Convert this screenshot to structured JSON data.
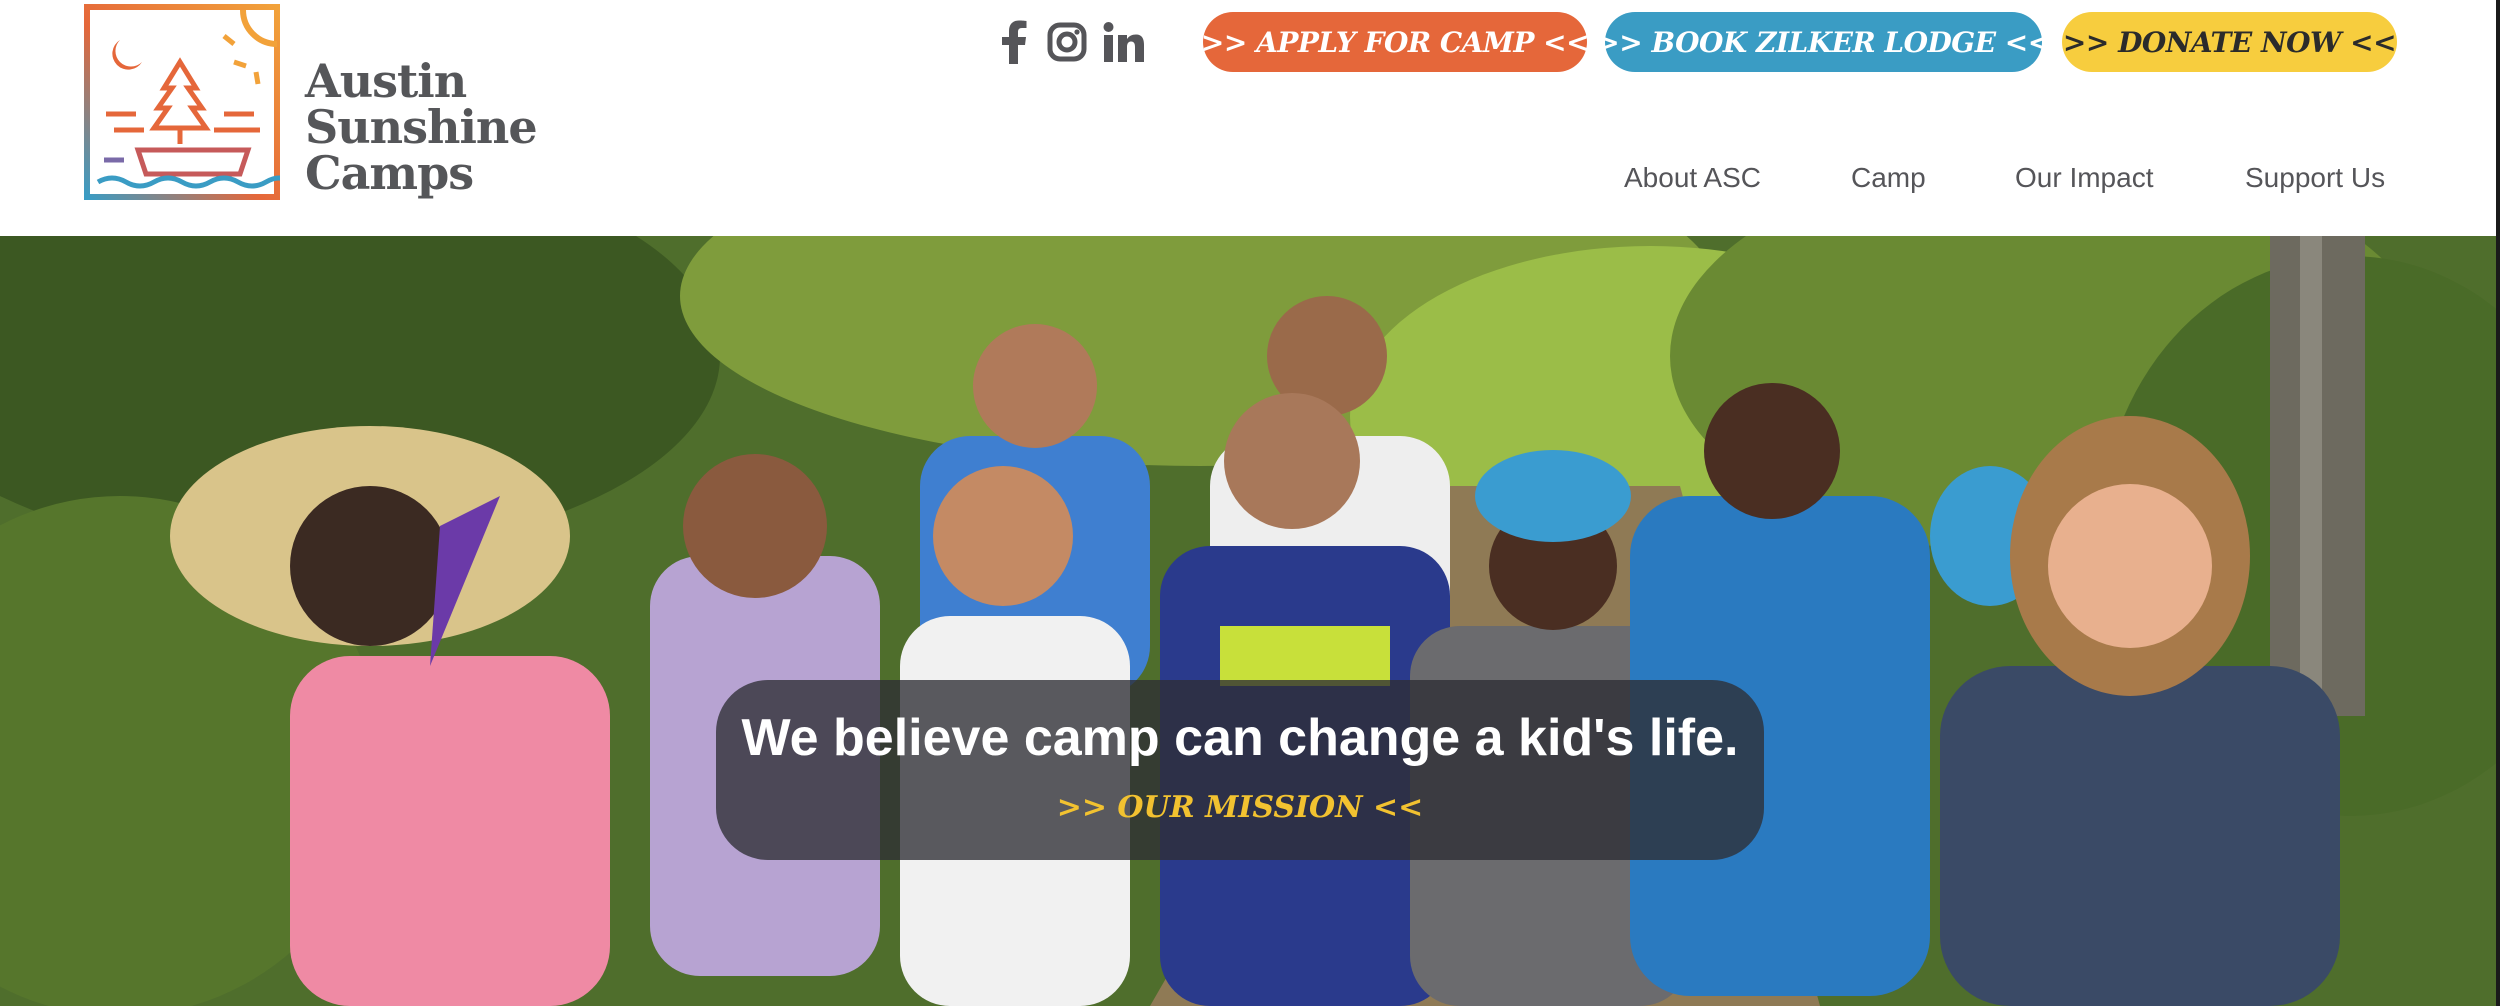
{
  "brand": {
    "name_lines": [
      "Austin",
      "Sunshine",
      "Camps"
    ],
    "logo_icon": "camp-logo-icon",
    "logo_colors": [
      "#f2a23a",
      "#e5673a",
      "#3a9cc4"
    ]
  },
  "social": [
    {
      "name": "facebook",
      "icon": "facebook-icon"
    },
    {
      "name": "instagram",
      "icon": "instagram-icon"
    },
    {
      "name": "linkedin",
      "icon": "linkedin-icon"
    }
  ],
  "cta_buttons": {
    "apply": {
      "label": ">> APPLY FOR CAMP <<",
      "color": "#e5673a"
    },
    "book": {
      "label": ">> BOOK ZILKER LODGE <<",
      "color": "#3a9cc4"
    },
    "donate": {
      "label": ">> DONATE NOW <<",
      "color": "#f7cd3e"
    }
  },
  "nav": {
    "items": [
      "About ASC",
      "Camp",
      "Our Impact",
      "Support Us"
    ]
  },
  "hero": {
    "image": "group-of-smiling-campers-on-forest-trail",
    "headline": "We believe camp can change a kid's life.",
    "link_label": ">> OUR MISSION <<",
    "link_color": "#f2c230"
  }
}
